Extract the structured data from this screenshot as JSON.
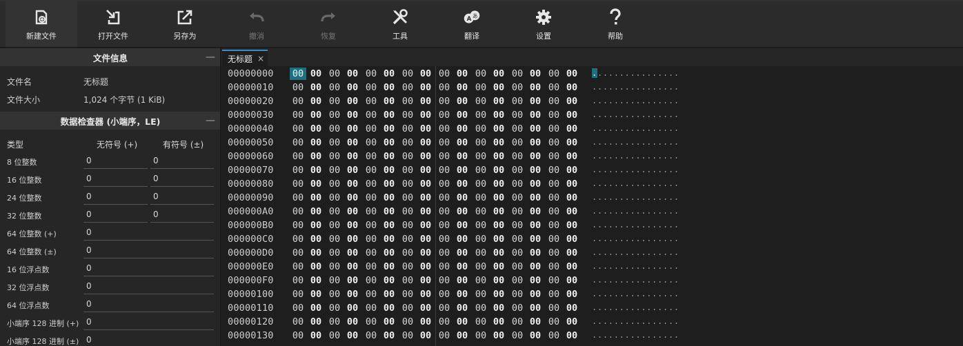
{
  "toolbar": {
    "buttons": [
      {
        "label": "新建文件",
        "icon": "new-file-icon",
        "enabled": true
      },
      {
        "label": "打开文件",
        "icon": "open-file-icon",
        "enabled": true
      },
      {
        "label": "另存为",
        "icon": "save-as-icon",
        "enabled": true
      },
      {
        "label": "撤消",
        "icon": "undo-icon",
        "enabled": false
      },
      {
        "label": "恢复",
        "icon": "redo-icon",
        "enabled": false
      },
      {
        "label": "工具",
        "icon": "tools-icon",
        "enabled": true
      },
      {
        "label": "翻译",
        "icon": "translate-icon",
        "enabled": true
      },
      {
        "label": "设置",
        "icon": "gear-icon",
        "enabled": true
      },
      {
        "label": "帮助",
        "icon": "help-icon",
        "enabled": true
      }
    ]
  },
  "file_info": {
    "title": "文件信息",
    "collapse": "—",
    "name_label": "文件名",
    "name_value": "无标题",
    "size_label": "文件大小",
    "size_value": "1,024 个字节 (1 KiB)"
  },
  "inspector": {
    "title": "数据检查器 (小端序，LE)",
    "collapse": "—",
    "col_type": "类型",
    "col_unsigned": "无符号 (+)",
    "col_signed": "有符号 (±)",
    "rows": [
      {
        "label": "8 位整数",
        "unsigned": "0",
        "signed": "0"
      },
      {
        "label": "16 位整数",
        "unsigned": "0",
        "signed": "0"
      },
      {
        "label": "24 位整数",
        "unsigned": "0",
        "signed": "0"
      },
      {
        "label": "32 位整数",
        "unsigned": "0",
        "signed": "0"
      },
      {
        "label": "64 位整数 (+)",
        "value": "0"
      },
      {
        "label": "64 位整数 (±)",
        "value": "0"
      },
      {
        "label": "16 位浮点数",
        "value": "0"
      },
      {
        "label": "32 位浮点数",
        "value": "0"
      },
      {
        "label": "64 位浮点数",
        "value": "0"
      },
      {
        "label": "小端序 128 进制 (+)",
        "value": "0"
      },
      {
        "label": "小端序 128 进制 (±)",
        "value": "0"
      }
    ]
  },
  "tab": {
    "label": "无标题",
    "close": "×"
  },
  "hex": {
    "offsets": [
      "00000000",
      "00000010",
      "00000020",
      "00000030",
      "00000040",
      "00000050",
      "00000060",
      "00000070",
      "00000080",
      "00000090",
      "000000A0",
      "000000B0",
      "000000C0",
      "000000D0",
      "000000E0",
      "000000F0",
      "00000100",
      "00000110",
      "00000120",
      "00000130"
    ],
    "byte": "00",
    "ascii": "................",
    "selected_offset": "00000000",
    "selection_color": "#1e6f82"
  }
}
